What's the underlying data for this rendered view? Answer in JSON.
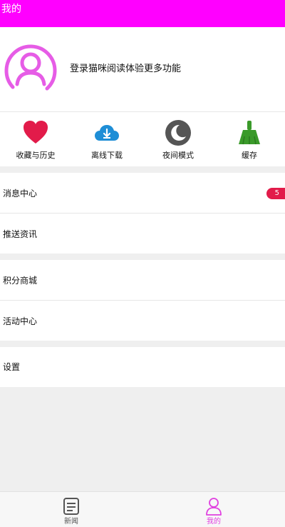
{
  "header": {
    "title": "我的"
  },
  "profile": {
    "login_prompt": "登录猫咪阅读体验更多功能"
  },
  "quick_actions": [
    {
      "label": "收藏与历史",
      "icon": "heart-icon",
      "color": "#e21b4a"
    },
    {
      "label": "离线下载",
      "icon": "cloud-download-icon",
      "color": "#1e8ed6"
    },
    {
      "label": "夜间模式",
      "icon": "moon-icon",
      "color": "#555555"
    },
    {
      "label": "缓存",
      "icon": "broom-icon",
      "color": "#3a9a2a"
    }
  ],
  "menu": {
    "messages": {
      "label": "消息中心",
      "badge": "5"
    },
    "push_news": {
      "label": "推送资讯"
    },
    "points_mall": {
      "label": "积分商城"
    },
    "activity_center": {
      "label": "活动中心"
    },
    "settings": {
      "label": "设置"
    }
  },
  "tabbar": {
    "news": {
      "label": "新闻"
    },
    "mine": {
      "label": "我的"
    }
  },
  "colors": {
    "accent": "#ff00ff",
    "active_tab": "#e040e0",
    "inactive_tab": "#555555",
    "badge": "#e21b4a"
  }
}
